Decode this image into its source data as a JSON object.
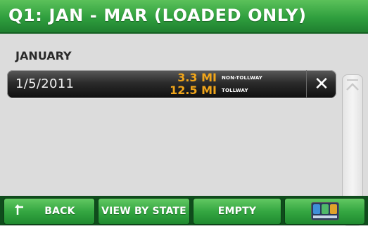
{
  "header": {
    "title": "Q1: JAN - MAR (LOADED ONLY)"
  },
  "list": {
    "month": "JANUARY",
    "rows": [
      {
        "date": "1/5/2011",
        "non_tollway_miles": "3.3 MI",
        "non_tollway_label": "NON-TOLLWAY",
        "tollway_miles": "12.5 MI",
        "tollway_label": "TOLLWAY",
        "delete_symbol": "✕"
      }
    ]
  },
  "footer": {
    "back_label": "BACK",
    "view_by_state_label": "VIEW BY STATE",
    "empty_label": "EMPTY",
    "dashboard_icon": "dashboard-icon"
  },
  "colors": {
    "title_green": "#2f9f3e",
    "mileage_orange": "#f0a51a"
  }
}
